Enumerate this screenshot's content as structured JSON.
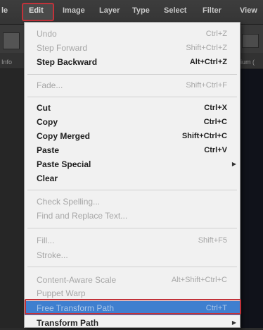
{
  "menubar": {
    "items": [
      {
        "label": "le"
      },
      {
        "label": "Edit"
      },
      {
        "label": "Image"
      },
      {
        "label": "Layer"
      },
      {
        "label": "Type"
      },
      {
        "label": "Select"
      },
      {
        "label": "Filter"
      },
      {
        "label": "View"
      }
    ]
  },
  "background": {
    "side_text": "ium (",
    "left_tab": "Info"
  },
  "edit_menu": {
    "items": [
      {
        "label": "Undo",
        "shortcut": "Ctrl+Z"
      },
      {
        "label": "Step Forward",
        "shortcut": "Shift+Ctrl+Z"
      },
      {
        "label": "Step Backward",
        "shortcut": "Alt+Ctrl+Z"
      },
      {
        "label": "Fade...",
        "shortcut": "Shift+Ctrl+F"
      },
      {
        "label": "Cut",
        "shortcut": "Ctrl+X"
      },
      {
        "label": "Copy",
        "shortcut": "Ctrl+C"
      },
      {
        "label": "Copy Merged",
        "shortcut": "Shift+Ctrl+C"
      },
      {
        "label": "Paste",
        "shortcut": "Ctrl+V"
      },
      {
        "label": "Paste Special",
        "submenu_icon": "submenu-arrow-icon"
      },
      {
        "label": "Clear"
      },
      {
        "label": "Check Spelling..."
      },
      {
        "label": "Find and Replace Text..."
      },
      {
        "label": "Fill...",
        "shortcut": "Shift+F5"
      },
      {
        "label": "Stroke..."
      },
      {
        "label": "Content-Aware Scale",
        "shortcut": "Alt+Shift+Ctrl+C"
      },
      {
        "label": "Puppet Warp"
      },
      {
        "label": "Free Transform Path",
        "shortcut": "Ctrl+T",
        "highlighted": true
      },
      {
        "label": "Transform Path",
        "submenu_icon": "submenu-arrow-icon"
      }
    ]
  },
  "colors": {
    "highlight": "#3f7fcf",
    "annotation_red": "#c2323a",
    "menu_bg": "#f1f1f1"
  }
}
